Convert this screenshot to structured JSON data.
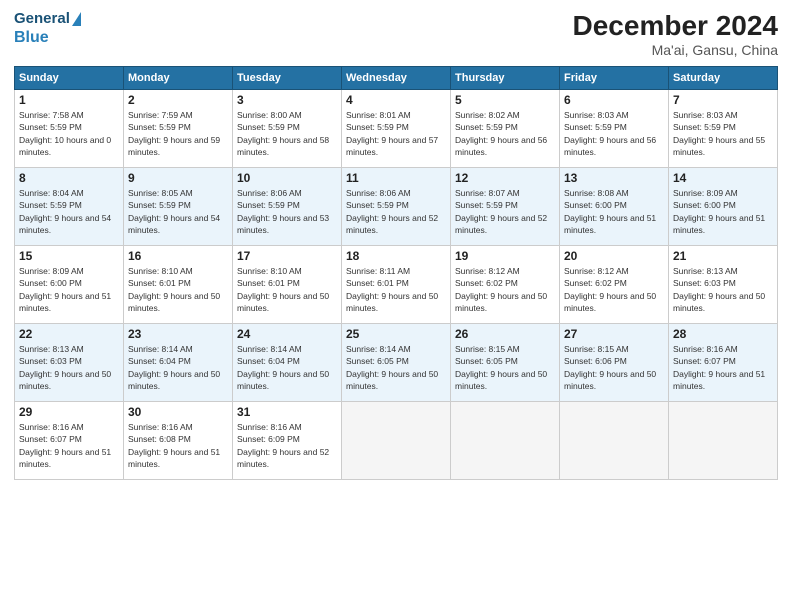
{
  "header": {
    "logo_general": "General",
    "logo_blue": "Blue",
    "title": "December 2024",
    "location": "Ma'ai, Gansu, China"
  },
  "columns": [
    "Sunday",
    "Monday",
    "Tuesday",
    "Wednesday",
    "Thursday",
    "Friday",
    "Saturday"
  ],
  "weeks": [
    [
      {
        "day": "1",
        "sunrise": "7:58 AM",
        "sunset": "5:59 PM",
        "daylight": "10 hours and 0 minutes."
      },
      {
        "day": "2",
        "sunrise": "7:59 AM",
        "sunset": "5:59 PM",
        "daylight": "9 hours and 59 minutes."
      },
      {
        "day": "3",
        "sunrise": "8:00 AM",
        "sunset": "5:59 PM",
        "daylight": "9 hours and 58 minutes."
      },
      {
        "day": "4",
        "sunrise": "8:01 AM",
        "sunset": "5:59 PM",
        "daylight": "9 hours and 57 minutes."
      },
      {
        "day": "5",
        "sunrise": "8:02 AM",
        "sunset": "5:59 PM",
        "daylight": "9 hours and 56 minutes."
      },
      {
        "day": "6",
        "sunrise": "8:03 AM",
        "sunset": "5:59 PM",
        "daylight": "9 hours and 56 minutes."
      },
      {
        "day": "7",
        "sunrise": "8:03 AM",
        "sunset": "5:59 PM",
        "daylight": "9 hours and 55 minutes."
      }
    ],
    [
      {
        "day": "8",
        "sunrise": "8:04 AM",
        "sunset": "5:59 PM",
        "daylight": "9 hours and 54 minutes."
      },
      {
        "day": "9",
        "sunrise": "8:05 AM",
        "sunset": "5:59 PM",
        "daylight": "9 hours and 54 minutes."
      },
      {
        "day": "10",
        "sunrise": "8:06 AM",
        "sunset": "5:59 PM",
        "daylight": "9 hours and 53 minutes."
      },
      {
        "day": "11",
        "sunrise": "8:06 AM",
        "sunset": "5:59 PM",
        "daylight": "9 hours and 52 minutes."
      },
      {
        "day": "12",
        "sunrise": "8:07 AM",
        "sunset": "5:59 PM",
        "daylight": "9 hours and 52 minutes."
      },
      {
        "day": "13",
        "sunrise": "8:08 AM",
        "sunset": "6:00 PM",
        "daylight": "9 hours and 51 minutes."
      },
      {
        "day": "14",
        "sunrise": "8:09 AM",
        "sunset": "6:00 PM",
        "daylight": "9 hours and 51 minutes."
      }
    ],
    [
      {
        "day": "15",
        "sunrise": "8:09 AM",
        "sunset": "6:00 PM",
        "daylight": "9 hours and 51 minutes."
      },
      {
        "day": "16",
        "sunrise": "8:10 AM",
        "sunset": "6:01 PM",
        "daylight": "9 hours and 50 minutes."
      },
      {
        "day": "17",
        "sunrise": "8:10 AM",
        "sunset": "6:01 PM",
        "daylight": "9 hours and 50 minutes."
      },
      {
        "day": "18",
        "sunrise": "8:11 AM",
        "sunset": "6:01 PM",
        "daylight": "9 hours and 50 minutes."
      },
      {
        "day": "19",
        "sunrise": "8:12 AM",
        "sunset": "6:02 PM",
        "daylight": "9 hours and 50 minutes."
      },
      {
        "day": "20",
        "sunrise": "8:12 AM",
        "sunset": "6:02 PM",
        "daylight": "9 hours and 50 minutes."
      },
      {
        "day": "21",
        "sunrise": "8:13 AM",
        "sunset": "6:03 PM",
        "daylight": "9 hours and 50 minutes."
      }
    ],
    [
      {
        "day": "22",
        "sunrise": "8:13 AM",
        "sunset": "6:03 PM",
        "daylight": "9 hours and 50 minutes."
      },
      {
        "day": "23",
        "sunrise": "8:14 AM",
        "sunset": "6:04 PM",
        "daylight": "9 hours and 50 minutes."
      },
      {
        "day": "24",
        "sunrise": "8:14 AM",
        "sunset": "6:04 PM",
        "daylight": "9 hours and 50 minutes."
      },
      {
        "day": "25",
        "sunrise": "8:14 AM",
        "sunset": "6:05 PM",
        "daylight": "9 hours and 50 minutes."
      },
      {
        "day": "26",
        "sunrise": "8:15 AM",
        "sunset": "6:05 PM",
        "daylight": "9 hours and 50 minutes."
      },
      {
        "day": "27",
        "sunrise": "8:15 AM",
        "sunset": "6:06 PM",
        "daylight": "9 hours and 50 minutes."
      },
      {
        "day": "28",
        "sunrise": "8:16 AM",
        "sunset": "6:07 PM",
        "daylight": "9 hours and 51 minutes."
      }
    ],
    [
      {
        "day": "29",
        "sunrise": "8:16 AM",
        "sunset": "6:07 PM",
        "daylight": "9 hours and 51 minutes."
      },
      {
        "day": "30",
        "sunrise": "8:16 AM",
        "sunset": "6:08 PM",
        "daylight": "9 hours and 51 minutes."
      },
      {
        "day": "31",
        "sunrise": "8:16 AM",
        "sunset": "6:09 PM",
        "daylight": "9 hours and 52 minutes."
      },
      null,
      null,
      null,
      null
    ]
  ]
}
